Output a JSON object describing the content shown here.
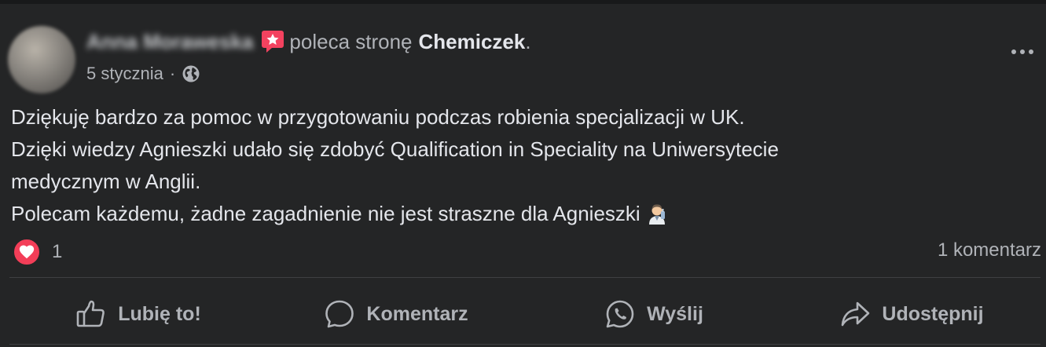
{
  "post": {
    "author_name": "Anna Moraweska",
    "recommends_text": "poleca stronę",
    "page_name": "Chemiczek",
    "page_suffix": ".",
    "date": "5 stycznia",
    "meta_separator": "·",
    "body_lines": [
      "Dziękuję bardzo za pomoc w przygotowaniu podczas robienia specjalizacji w UK.",
      "Dzięki wiedzy Agnieszki udało się zdobyć Qualification in Speciality na Uniwersytecie",
      "medycznym w Anglii.",
      "Polecam każdemu, żadne zagadnienie nie jest straszne dla Agnieszki"
    ],
    "reaction_count": "1",
    "comments_count": "1 komentarz",
    "colors": {
      "heart": "#f33e58",
      "badge": "#f3425f"
    }
  },
  "actions": {
    "like": "Lubię to!",
    "comment": "Komentarz",
    "send": "Wyślij",
    "share": "Udostępnij"
  }
}
